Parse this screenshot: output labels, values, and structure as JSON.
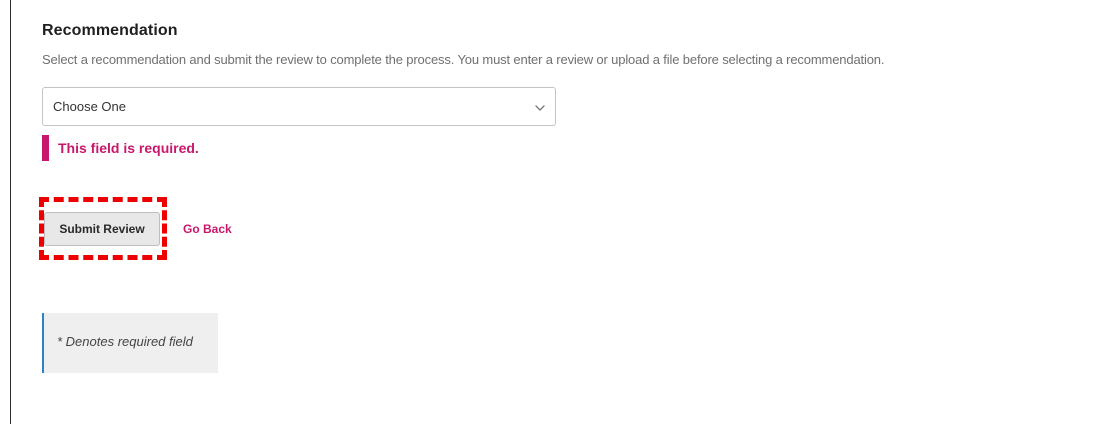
{
  "recommendation": {
    "heading": "Recommendation",
    "description": "Select a recommendation and submit the review to complete the process. You must enter a review or upload a file before selecting a recommendation.",
    "select": {
      "selected_value": "Choose One",
      "icon": "chevron-down-icon"
    },
    "error_message": "This field is required."
  },
  "actions": {
    "submit_label": "Submit Review",
    "go_back_label": "Go Back"
  },
  "note": {
    "text": "* Denotes required field"
  },
  "colors": {
    "error": "#c8186c",
    "link": "#c8186c",
    "highlight": "#ee0000",
    "note_accent": "#2f82c2"
  }
}
